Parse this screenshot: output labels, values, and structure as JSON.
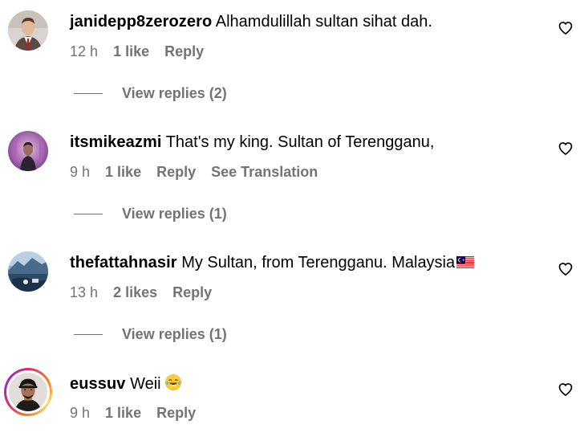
{
  "comments": [
    {
      "username": "janidepp8zerozero",
      "text": "Alhamdulillah sultan sihat dah.",
      "time": "12 h",
      "likes": "1 like",
      "reply": "Reply",
      "translate": "",
      "view_replies": "View replies (2)",
      "avatar_icon": "avatar-suit-man"
    },
    {
      "username": "itsmikeazmi",
      "text": "That's my king. Sultan of Terengganu,",
      "time": "9 h",
      "likes": "1 like",
      "reply": "Reply",
      "translate": "See Translation",
      "view_replies": "View replies (1)",
      "avatar_icon": "avatar-person-purple"
    },
    {
      "username": "thefattahnasir",
      "text": "My Sultan, from Terengganu. Malaysia",
      "time": "13 h",
      "likes": "2 likes",
      "reply": "Reply",
      "translate": "",
      "view_replies": "View replies (1)",
      "avatar_icon": "avatar-landscape"
    },
    {
      "username": "eussuv",
      "text": "Weii",
      "time": "9 h",
      "likes": "1 like",
      "reply": "Reply",
      "translate": "",
      "view_replies": "",
      "avatar_icon": "avatar-cap-man"
    }
  ],
  "colors": {
    "meta_gray": "#737373",
    "story_ring_start": "#d62976",
    "story_ring_end": "#feda75"
  }
}
